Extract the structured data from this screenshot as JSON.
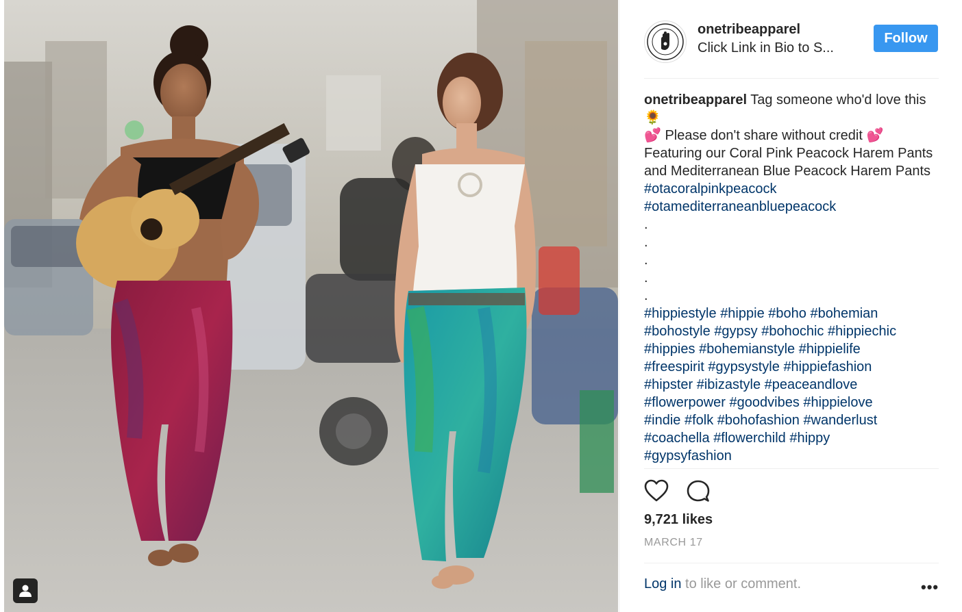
{
  "post": {
    "username": "onetribeapparel",
    "bio_link": "Click Link in Bio to S...",
    "follow_label": "Follow",
    "avatar_text_top": "ONE TRIBE",
    "avatar_text_bottom": "APPAREL"
  },
  "caption": {
    "username": "onetribeapparel",
    "line1_text": "Tag someone who'd love",
    "line2_text": "this",
    "line2_emoji": "🌻",
    "line3_text": "Please don't share without credit",
    "line3_emoji": "💕",
    "line4_text": "Featuring our Coral Pink Peacock Harem Pants and Mediterranean Blue Peacock Harem Pants",
    "hashtags_primary": [
      "#otacoralpinkpeacock",
      "#otamediterraneanbluepeacock"
    ],
    "dots": [
      ".",
      ".",
      ".",
      ".",
      "."
    ],
    "hashtags": [
      "#hippiestyle",
      "#hippie",
      "#boho",
      "#bohemian",
      "#bohostyle",
      "#gypsy",
      "#bohochic",
      "#hippiechic",
      "#hippies",
      "#bohemianstyle",
      "#hippielife",
      "#freespirit",
      "#gypsystyle",
      "#hippiefashion",
      "#hipster",
      "#ibizastyle",
      "#peaceandlove",
      "#flowerpower",
      "#goodvibes",
      "#hippielove",
      "#indie",
      "#folk",
      "#bohofashion",
      "#wanderlust",
      "#coachella",
      "#flowerchild",
      "#hippy",
      "#gypsyfashion"
    ]
  },
  "stats": {
    "likes": "9,721 likes",
    "date": "MARCH 17"
  },
  "comment": {
    "login_label": "Log in",
    "rest": " to like or comment.",
    "more": "•••"
  },
  "icons": {
    "like": "heart-icon",
    "comment": "comment-icon",
    "tag": "user-tag-icon",
    "more": "more-options-icon"
  },
  "colors": {
    "follow_button": "#3897f0",
    "link": "#003569",
    "muted": "#999999",
    "text": "#262626"
  }
}
